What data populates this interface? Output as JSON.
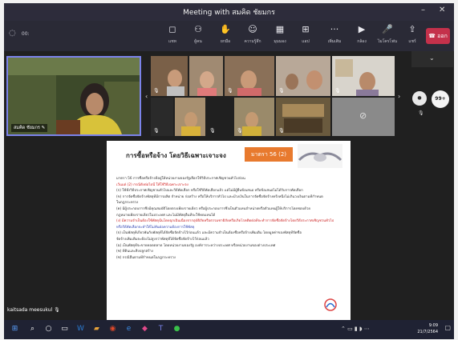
{
  "window": {
    "title": "Meeting with สมคิด ชัยมกร"
  },
  "toolbar": {
    "time": "00:",
    "buttons": [
      {
        "icon": "chat-icon",
        "label": "แชท"
      },
      {
        "icon": "people-icon",
        "label": "ผู้คน"
      },
      {
        "icon": "raise-hand-icon",
        "label": "ยกมือ"
      },
      {
        "icon": "reactions-icon",
        "label": "ความรู้สึก"
      },
      {
        "icon": "view-icon",
        "label": "มุมมอง"
      },
      {
        "icon": "apps-icon",
        "label": "แอป"
      },
      {
        "icon": "more-icon",
        "label": "เพิ่มเติม"
      },
      {
        "icon": "camera-icon",
        "label": "กล้อง"
      },
      {
        "icon": "mic-icon",
        "label": "ไมโครโฟน"
      },
      {
        "icon": "share-icon",
        "label": "แชร์"
      }
    ],
    "leave": "ออก"
  },
  "self_view": {
    "name": "สมคิด ชัยมกร"
  },
  "participants_count": "99+",
  "presenter": "kaitsada meesukul",
  "slide": {
    "title": "การซื้อหรือจ้าง โดยวิธีเฉพาะเจาะจง",
    "badge": "มาตรา 56 (2)",
    "lines": [
      {
        "text": "มาตรา 56  การซื้อหรือจ้างที่อยู่ให้หน่วยงานของรัฐเลือกใช้วิธีประกาศเชิญชวนทั่วไปก่อน",
        "style": "normal"
      },
      {
        "text": "เว้นแต่ (2) กรณีดังต่อไปนี้ ให้ใช้วิธีเฉพาะเจาะจง",
        "style": "red"
      },
      {
        "text": "(ก) ใช้ทั้งวิธีประกาศเชิญชวนทั่วไปและวิธีคัดเลือก หรือใช้วิธีคัดเลือกแล้ว แต่ไม่มีผู้ยื่นข้อเสนอ หรือข้อเสนอไม่ได้รับการคัดเลือก",
        "style": "normal"
      },
      {
        "text": "(ข) การจัดซื้อจัดจ้างพัสดุที่มีการผลิต จำหน่าย ก่อสร้าง หรือให้บริการทั่วไป และมีวงเงินในการจัดซื้อจัดจ้างครั้งหนึ่งไม่เกินวงเงินตามที่กำหนด",
        "style": "normal"
      },
      {
        "text": "ในกฎกระทรวง",
        "style": "normal"
      },
      {
        "text": "(ค) มีผู้ประกอบการซึ่งมีคุณสมบัติโดยตรงเพียงรายเดียว หรือผู้ประกอบการซึ่งเป็นตัวแทนจำหน่ายหรือตัวแทนผู้ให้บริการโดยชอบด้วย",
        "style": "normal"
      },
      {
        "text": "กฎหมายเพียงรายเดียวในประเทศ และไม่มีพัสดุอื่นที่จะใช้ทดแทนได้",
        "style": "normal"
      },
      {
        "text": "(ง) มีความจำเป็นต้องใช้พัสดุนั้นโดยฉุกเฉินเนื่องจากอุบัติภัยหรือธรรมชาติภัยหรือเกิดโรคติดต่อที่จะทำการจัดซื้อจัดจ้างโดยวิธีประกาศเชิญชวนทั่วไป",
        "style": "red2"
      },
      {
        "text": "หรือวิธีคัดเลือกจะทำให้ไม่ทันต่อความต้องการใช้พัสดุ",
        "style": "blue"
      },
      {
        "text": "(จ) เป็นพัสดุที่เกี่ยวพันกับพัสดุที่ได้จัดซื้อจัดจ้างไว้ก่อนแล้ว และมีความจำเป็นต้องซื้อหรือจ้างเพิ่มเติม โดยมูลค่าของพัสดุที่จัดซื้อ",
        "style": "normal"
      },
      {
        "text": "จัดจ้างเพิ่มเติมจะต้องไม่สูงกว่าพัสดุที่ได้จัดซื้อจัดจ้างไว้ก่อนแล้ว",
        "style": "normal"
      },
      {
        "text": "(ฉ) เป็นพัสดุที่จะขายทอดตลาด โดยหน่วยงานของรัฐ องค์การระหว่างประเทศ หรือหน่วยงานของต่างประเทศ",
        "style": "normal"
      },
      {
        "text": "(ช) ที่ดินและสิ่งปลูกสร้าง",
        "style": "normal"
      },
      {
        "text": "(ซ) กรณีอื่นตามที่กำหนดในกฎกระทรวง",
        "style": "normal"
      }
    ]
  },
  "clock": {
    "time": "9:09",
    "date": "21/7/2564"
  },
  "colors": {
    "accent": "#7b83eb",
    "leave": "#c4314b",
    "badge": "#e87a2e",
    "taskbar": "#1f2233"
  }
}
